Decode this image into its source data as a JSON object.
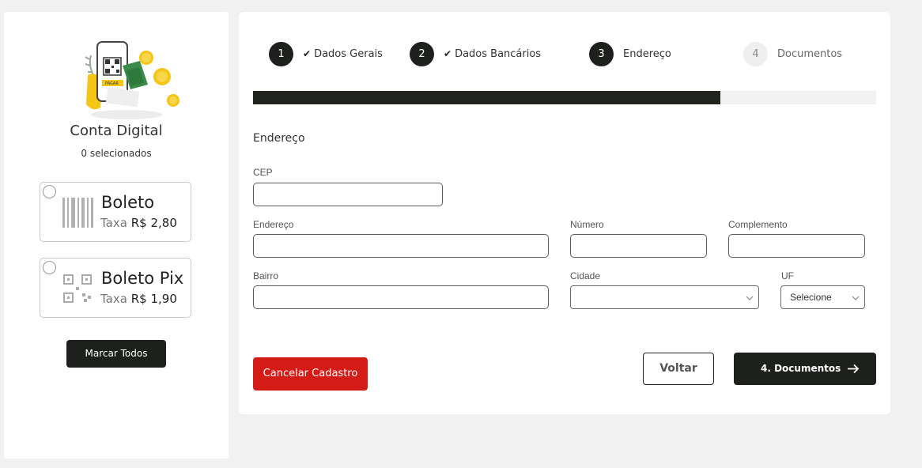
{
  "sidebar": {
    "title": "Conta Digital",
    "selected_count": "0 selecionados",
    "products": [
      {
        "name": "Boleto",
        "fee_label": "Taxa",
        "fee_value": "R$ 2,80",
        "icon": "barcode-icon"
      },
      {
        "name": "Boleto Pix",
        "fee_label": "Taxa",
        "fee_value": "R$ 1,90",
        "icon": "qr-code-icon"
      }
    ],
    "select_all_label": "Marcar Todos",
    "hero_icon": "phone-qr-payment-illustration",
    "hero_badge_text": "PAGAR"
  },
  "steps": [
    {
      "number": "1",
      "label": "Dados Gerais",
      "status": "done"
    },
    {
      "number": "2",
      "label": "Dados Bancários",
      "status": "done"
    },
    {
      "number": "3",
      "label": "Endereço",
      "status": "current"
    },
    {
      "number": "4",
      "label": "Documentos",
      "status": "pending"
    }
  ],
  "progress_fraction": 0.75,
  "form": {
    "section_title": "Endereço",
    "fields": {
      "cep": {
        "label": "CEP",
        "value": ""
      },
      "endereco": {
        "label": "Endereço",
        "value": ""
      },
      "numero": {
        "label": "Número",
        "value": ""
      },
      "complemento": {
        "label": "Complemento",
        "value": ""
      },
      "bairro": {
        "label": "Bairro",
        "value": ""
      },
      "cidade": {
        "label": "Cidade",
        "value": ""
      },
      "uf": {
        "label": "UF",
        "value": "Selecione"
      }
    }
  },
  "actions": {
    "cancel_label": "Cancelar Cadastro",
    "back_label": "Voltar",
    "next_label": "4. Documentos"
  },
  "colors": {
    "dark": "#1e201d",
    "danger": "#d51b16",
    "coin": "#f5c518"
  }
}
